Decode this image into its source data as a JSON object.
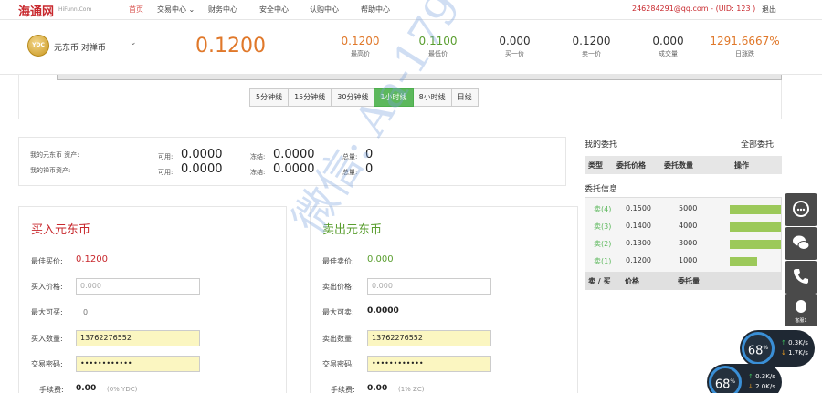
{
  "nav": {
    "logo": "海通网",
    "logo_sub": "HiFunn.Com",
    "items": [
      "首页",
      "交易中心",
      "财务中心",
      "安全中心",
      "认购中心",
      "帮助中心"
    ],
    "account": "246284291@qq.com - (UID: 123 )",
    "logout": "退出"
  },
  "market": {
    "coin_badge": "YDC",
    "pair": "元东币 对禅币",
    "last_price": "0.1200",
    "stats": [
      {
        "value": "0.1200",
        "label": "最高价",
        "color": "#e0782a"
      },
      {
        "value": "0.1100",
        "label": "最低价",
        "color": "#5a9e2f"
      },
      {
        "value": "0.000",
        "label": "买一价",
        "color": "#333333"
      },
      {
        "value": "0.1200",
        "label": "卖一价",
        "color": "#333333"
      },
      {
        "value": "0.000",
        "label": "成交量",
        "color": "#333333"
      },
      {
        "value": "1291.6667%",
        "label": "日涨跌",
        "color": "#e0782a"
      }
    ]
  },
  "tabs": [
    "5分钟线",
    "15分钟线",
    "30分钟线",
    "1小时线",
    "8小时线",
    "日线"
  ],
  "active_tab": "1小时线",
  "assets": {
    "row1_label": "我的元东币 资产:",
    "row2_label": "我的禅币资产:",
    "available_label": "可用:",
    "frozen_label": "冻结:",
    "total_label": "总量:",
    "row1": {
      "available": "0.0000",
      "frozen": "0.0000",
      "total": "0"
    },
    "row2": {
      "available": "0.0000",
      "frozen": "0.0000",
      "total": "0"
    }
  },
  "buy": {
    "title": "买入元东币",
    "best_label": "最佳买价:",
    "best_value": "0.1200",
    "price_label": "买入价格:",
    "price_placeholder": "0.000",
    "max_label": "最大可买:",
    "max_value": "0",
    "qty_label": "买入数量:",
    "qty_value": "13762276552",
    "pwd_label": "交易密码:",
    "pwd_value": "••••••••••••",
    "fee_label": "手续费:",
    "fee_value": "0.00",
    "fee_note": "(0% YDC)"
  },
  "sell": {
    "title": "卖出元东币",
    "best_label": "最佳卖价:",
    "best_value": "0.000",
    "price_label": "卖出价格:",
    "price_placeholder": "0.000",
    "max_label": "最大可卖:",
    "max_value": "0.0000",
    "qty_label": "卖出数量:",
    "qty_value": "13762276552",
    "pwd_label": "交易密码:",
    "pwd_value": "••••••••••••",
    "fee_label": "手续费:",
    "fee_value": "0.00",
    "fee_note": "(1% ZC)"
  },
  "my_orders": {
    "title": "我的委托",
    "all_link": "全部委托",
    "headers": [
      "类型",
      "委托价格",
      "委托数量",
      "操作"
    ]
  },
  "order_book": {
    "title": "委托信息",
    "rows": [
      {
        "type": "卖(4)",
        "price": "0.1500",
        "qty": "5000",
        "depth": 1.0
      },
      {
        "type": "卖(3)",
        "price": "0.1400",
        "qty": "4000",
        "depth": 1.0
      },
      {
        "type": "卖(2)",
        "price": "0.1300",
        "qty": "3000",
        "depth": 1.0
      },
      {
        "type": "卖(1)",
        "price": "0.1200",
        "qty": "1000",
        "depth": 0.53
      }
    ],
    "footer_headers": [
      "卖 / 买",
      "价格",
      "委托量"
    ]
  },
  "float_caption": "客服1",
  "speed_widgets": [
    {
      "percent": "68",
      "up": "0.3K/s",
      "down": "1.7K/s"
    },
    {
      "percent": "68",
      "up": "0.3K/s",
      "down": "2.0K/s"
    }
  ],
  "watermark": "微信: Aa-179"
}
